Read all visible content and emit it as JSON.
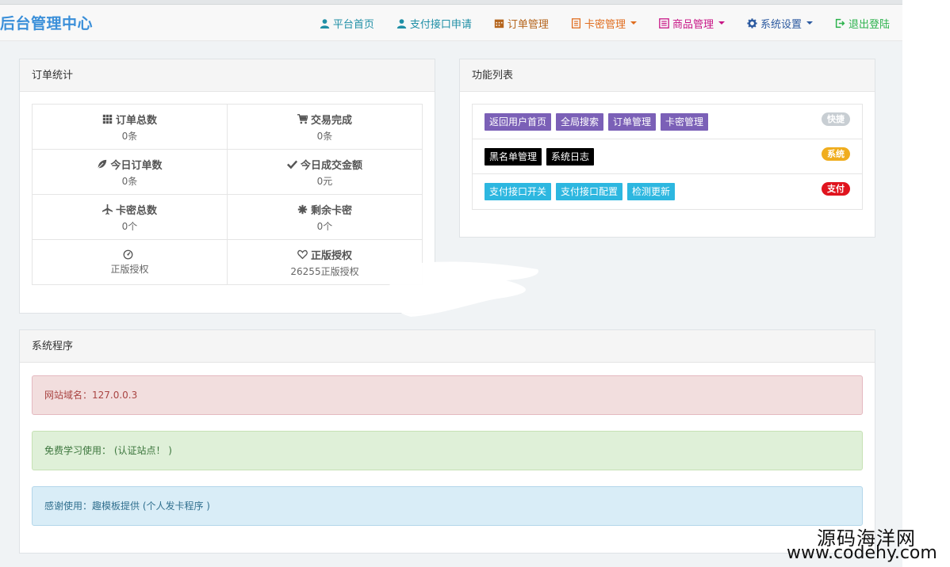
{
  "navbar": {
    "brand": "后台管理中心",
    "items": [
      {
        "label": "平台首页",
        "icon": "user-icon",
        "color": "#1f8fa6"
      },
      {
        "label": "支付接口申请",
        "icon": "user-icon",
        "color": "#1f8fa6"
      },
      {
        "label": "订单管理",
        "icon": "calendar-icon",
        "color": "#b5651d"
      },
      {
        "label": "卡密管理",
        "icon": "book-icon",
        "color": "#e06d1f"
      },
      {
        "label": "商品管理",
        "icon": "list-icon",
        "color": "#c71585"
      },
      {
        "label": "系统设置",
        "icon": "gear-icon",
        "color": "#2c5aa0"
      },
      {
        "label": "退出登陆",
        "icon": "logout-icon",
        "color": "#2bb24c"
      }
    ]
  },
  "order_stats": {
    "title": "订单统计",
    "cells": [
      {
        "label": "订单总数",
        "value": "0条",
        "icon": "grid-icon"
      },
      {
        "label": "交易完成",
        "value": "0条",
        "icon": "cart-icon"
      },
      {
        "label": "今日订单数",
        "value": "0条",
        "icon": "leaf-icon"
      },
      {
        "label": "今日成交金额",
        "value": "0元",
        "icon": "check-icon"
      },
      {
        "label": "卡密总数",
        "value": "0个",
        "icon": "plane-icon"
      },
      {
        "label": "剩余卡密",
        "value": "0个",
        "icon": "asterisk-icon"
      },
      {
        "label": "",
        "value": "正版授权",
        "icon": "dashboard-icon"
      },
      {
        "label": "正版授权",
        "value": "26255正版授权",
        "icon": "heart-icon"
      }
    ]
  },
  "functions": {
    "title": "功能列表",
    "rows": [
      {
        "badge": "快捷",
        "badge_color": "#c8ced3",
        "btn_color": "#7b60b7",
        "buttons": [
          "返回用户首页",
          "全局搜索",
          "订单管理",
          "卡密管理"
        ]
      },
      {
        "badge": "系统",
        "badge_color": "#f0ad1e",
        "btn_color": "#000000",
        "buttons": [
          "黑名单管理",
          "系统日志"
        ]
      },
      {
        "badge": "支付",
        "badge_color": "#e0141e",
        "btn_color": "#2db7e0",
        "buttons": [
          "支付接口开关",
          "支付接口配置",
          "检测更新"
        ]
      }
    ]
  },
  "system": {
    "title": "系统程序",
    "alerts": [
      {
        "text": "网站域名：127.0.0.3",
        "bg": "#f2dede",
        "border": "#e4b9c0",
        "color": "#a94442"
      },
      {
        "text": "免费学习使用： (认证站点！ )",
        "bg": "#dff0d8",
        "border": "#c6e1b4",
        "color": "#3c763d"
      },
      {
        "text": "感谢使用：趣模板提供 (个人发卡程序 )",
        "bg": "#d9edf7",
        "border": "#b3d6ea",
        "color": "#31708f"
      }
    ]
  },
  "watermark": {
    "line1": "源码海洋网",
    "line2": "www.codehy.com"
  }
}
